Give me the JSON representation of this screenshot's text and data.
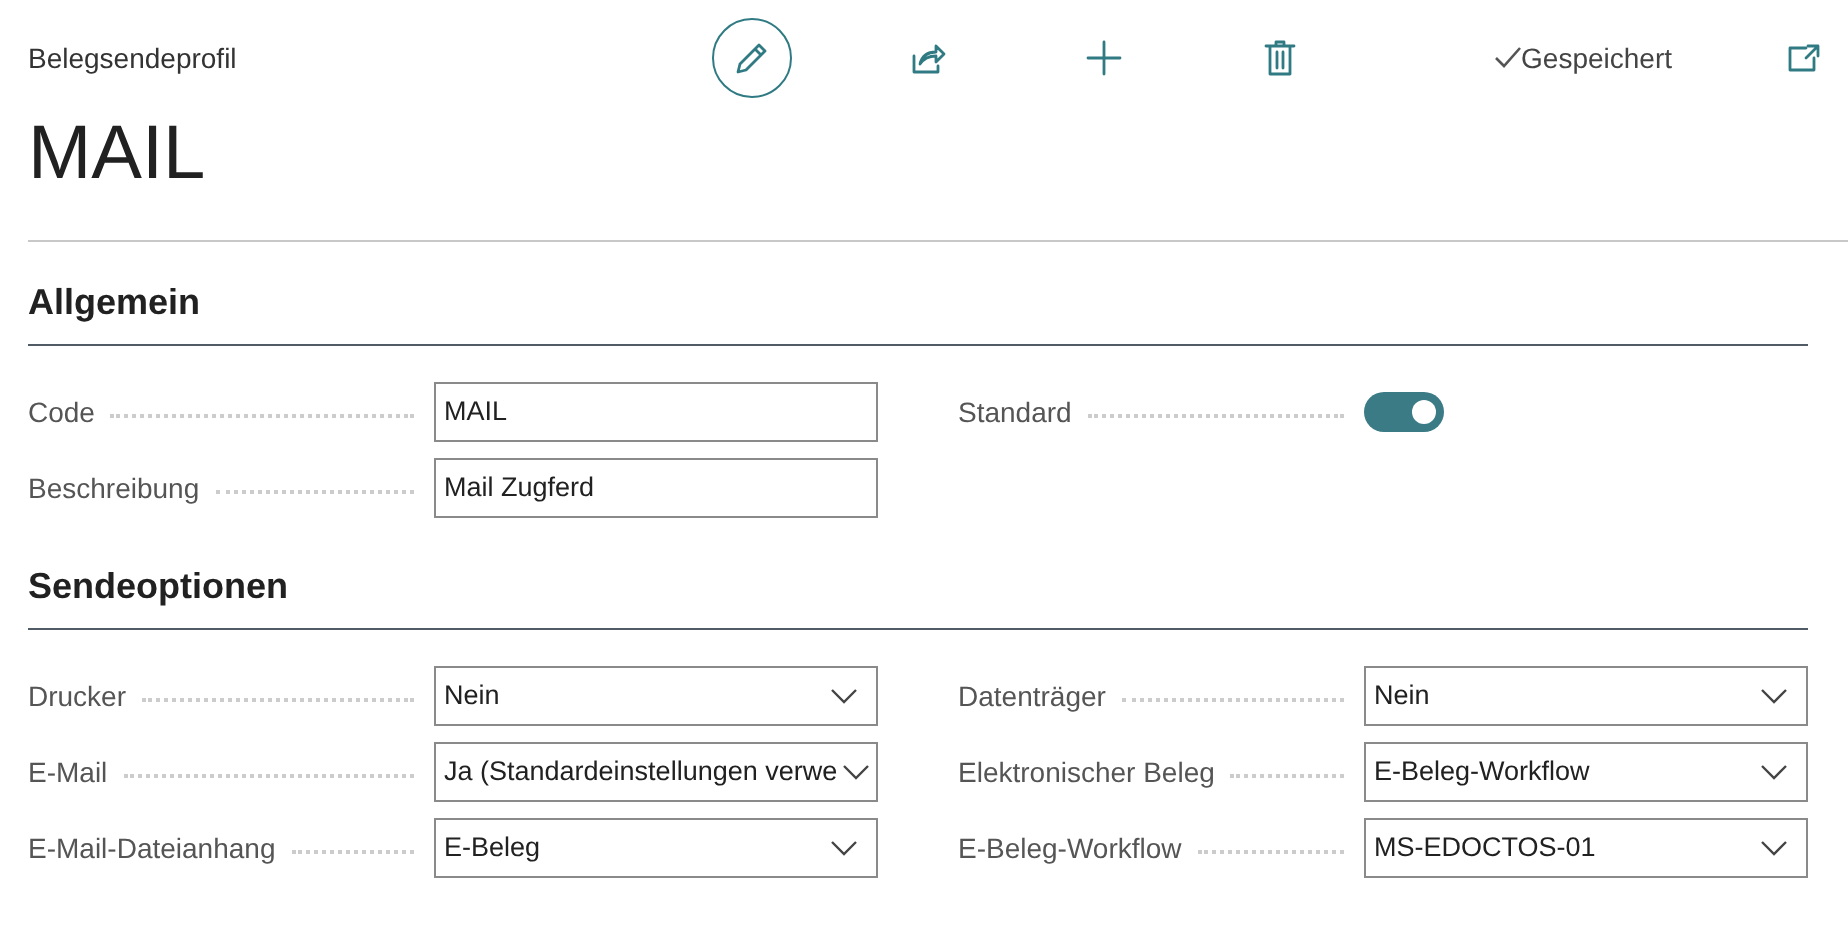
{
  "header": {
    "caption": "Belegsendeprofil",
    "status": "Gespeichert",
    "title": "MAIL"
  },
  "sections": [
    {
      "title": "Allgemein",
      "columns": [
        [
          {
            "label": "Code",
            "kind": "text",
            "value": "MAIL"
          },
          {
            "label": "Beschreibung",
            "kind": "text",
            "value": "Mail Zugferd"
          }
        ],
        [
          {
            "label": "Standard",
            "kind": "toggle",
            "on": true
          }
        ]
      ]
    },
    {
      "title": "Sendeoptionen",
      "columns": [
        [
          {
            "label": "Drucker",
            "kind": "select",
            "value": "Nein"
          },
          {
            "label": "E-Mail",
            "kind": "select",
            "value": "Ja (Standardeinstellungen verwe"
          },
          {
            "label": "E-Mail-Dateianhang",
            "kind": "select",
            "value": "E-Beleg"
          }
        ],
        [
          {
            "label": "Datenträger",
            "kind": "select",
            "value": "Nein"
          },
          {
            "label": "Elektronischer Beleg",
            "kind": "select",
            "value": "E-Beleg-Workflow"
          },
          {
            "label": "E-Beleg-Workflow",
            "kind": "select",
            "value": "MS-EDOCTOS-01"
          }
        ]
      ]
    }
  ]
}
